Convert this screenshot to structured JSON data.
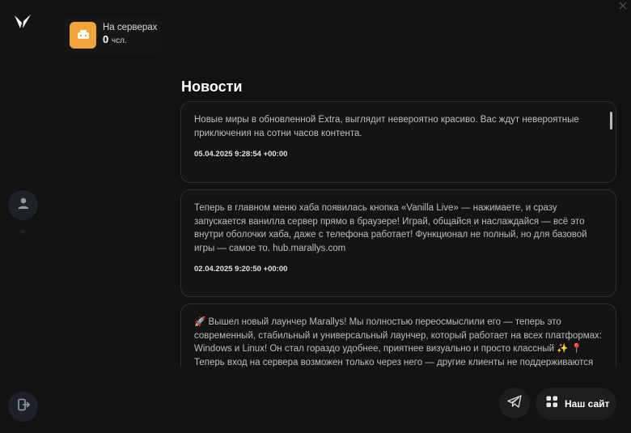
{
  "servers_stat": {
    "label": "На серверах",
    "value": "0",
    "unit": "чсл.",
    "icon": "server-icon",
    "accent": "#f2a33a"
  },
  "news": {
    "title": "Новости",
    "items": [
      {
        "text": "Новые миры в обновленной Extra, выглядит невероятно красиво. Вас ждут невероятные приключения на сотни часов контента.",
        "date": "05.04.2025 9:28:54 +00:00"
      },
      {
        "text": "Теперь в главном меню хаба появилась кнопка «Vanilla Live» — нажимаете, и сразу запускается ванилла сервер прямо в браузере! Играй, общайся и наслаждайся — всё это внутри оболочки хаба, даже с телефона работает! Функционал не полный, но для базовой игры — самое то. hub.marallys.com",
        "date": "02.04.2025 9:20:50 +00:00"
      },
      {
        "text": "🚀 Вышел новый лаунчер Marallys! Мы полностью переосмыслили его — теперь это современный, стабильный и универсальный лаунчер, который работает на всех платформах: Windows и Linux! Он стал гораздо удобнее, приятнее визуально и просто классный ✨ 📍Теперь вход на сервера возможен только через него — другие клиенты не поддерживаются"
      }
    ]
  },
  "actions": {
    "telegram_icon": "telegram-icon",
    "site_label": "Наш сайт",
    "site_icon": "grid-icon"
  },
  "sidebar": {
    "logo": "marallys-logo",
    "profile_icon": "user-icon",
    "logout_icon": "logout-icon"
  }
}
